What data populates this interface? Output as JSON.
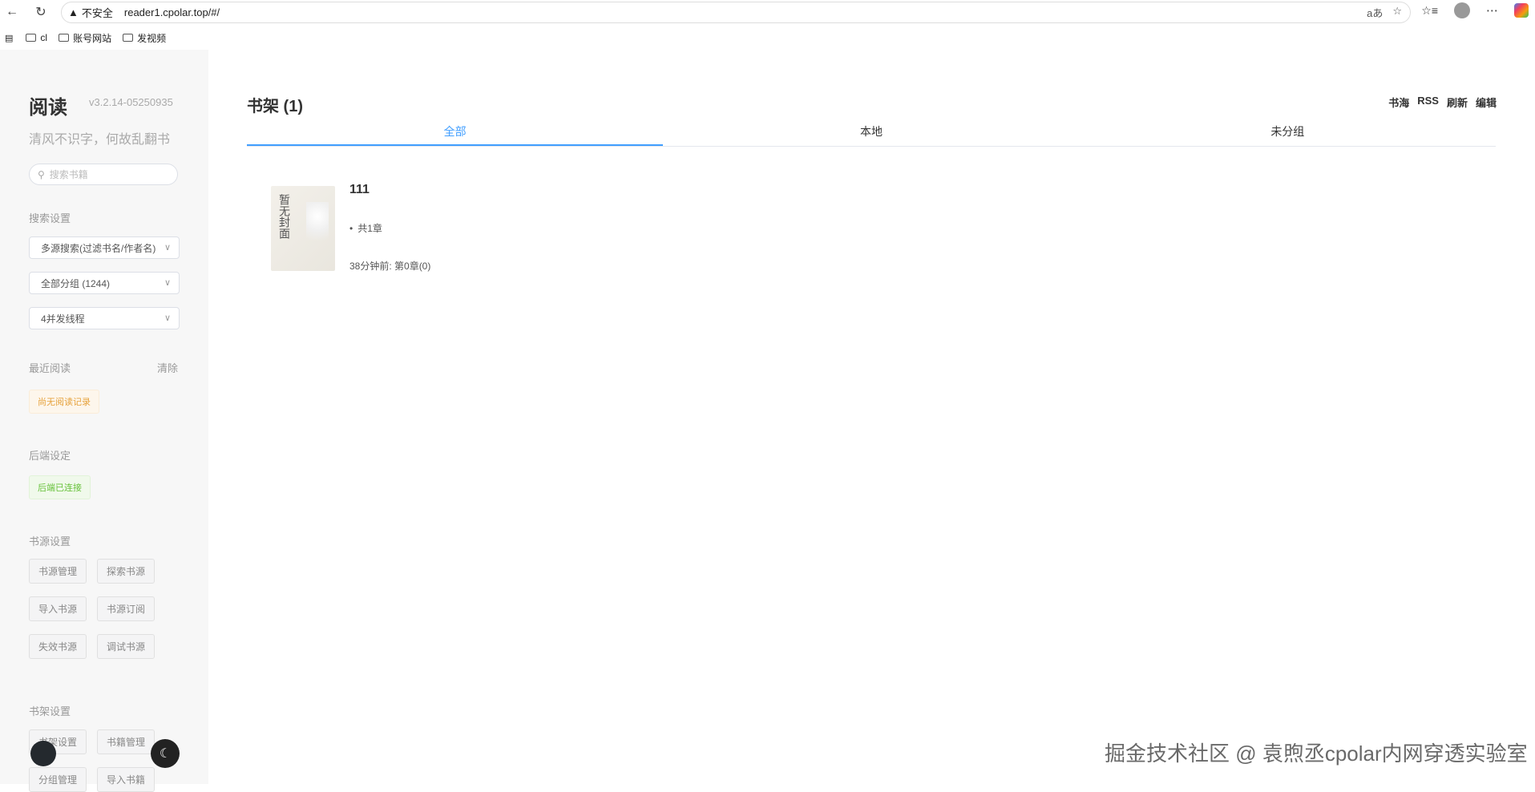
{
  "browser": {
    "security_label": "不安全",
    "url": "reader1.cpolar.top/#/",
    "read_aloud": "aあ",
    "bookmarks": [
      "cl",
      "账号网站",
      "发视频"
    ]
  },
  "sidebar": {
    "logo": "阅读",
    "version": "v3.2.14-05250935",
    "tagline": "清风不识字，何故乱翻书",
    "search_placeholder": "搜索书籍",
    "search_settings_title": "搜索设置",
    "search_mode": "多源搜索(过滤书名/作者名)",
    "group": "全部分组 (1244)",
    "threads": "4并发线程",
    "recent_title": "最近阅读",
    "clear_label": "清除",
    "no_record": "尚无阅读记录",
    "backend_title": "后端设定",
    "backend_status": "后端已连接",
    "source_title": "书源设置",
    "source_buttons": [
      "书源管理",
      "探索书源",
      "导入书源",
      "书源订阅",
      "失效书源",
      "调试书源"
    ],
    "shelf_title": "书架设置",
    "shelf_buttons": [
      "书架设置",
      "书籍管理",
      "分组管理",
      "导入书籍"
    ]
  },
  "main": {
    "title": "书架 (1)",
    "actions": [
      "书海",
      "RSS",
      "刷新",
      "编辑"
    ],
    "tabs": [
      "全部",
      "本地",
      "未分组"
    ],
    "active_tab": 0,
    "books": [
      {
        "name": "111",
        "cover_text": "暂无封面",
        "chapters": "共1章",
        "last_read": "38分钟前: 第0章(0)"
      }
    ]
  },
  "watermark": "掘金技术社区 @ 袁煦丞cpolar内网穿透实验室"
}
